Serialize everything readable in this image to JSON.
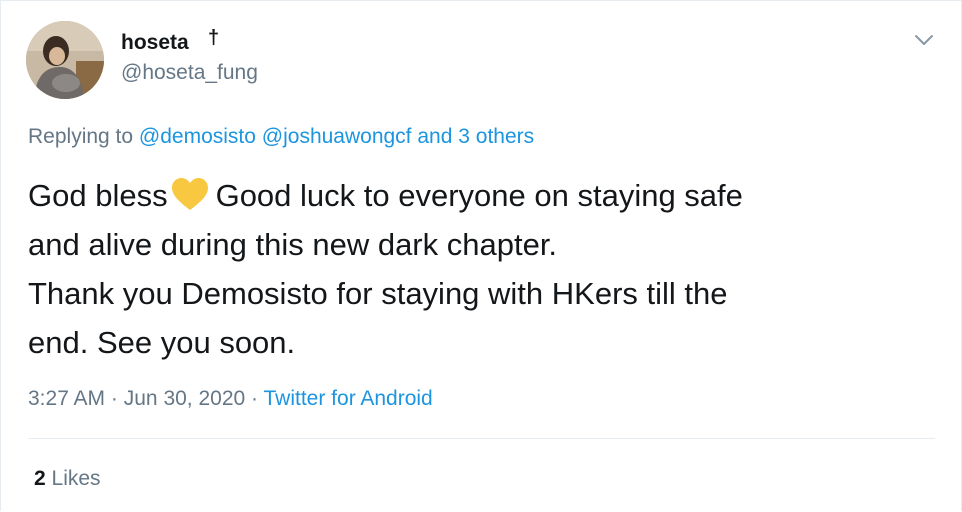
{
  "author": {
    "display_name": "hoseta",
    "name_suffix": "†",
    "handle": "@hoseta_fung"
  },
  "reply": {
    "prefix": "Replying to",
    "mentions": [
      "@demosisto",
      "@joshuawongcf"
    ],
    "others": "and 3 others"
  },
  "tweet": {
    "line1_before": "God bless",
    "emoji": "yellow-heart-icon",
    "line1_after": "Good luck to everyone on staying safe",
    "line2": "and alive during this new dark chapter.",
    "line3": "Thank you Demosisto for staying with HKers till the",
    "line4": "end. See you soon."
  },
  "meta": {
    "time": "3:27 AM",
    "separator": "·",
    "date": "Jun 30, 2020",
    "source": "Twitter for Android"
  },
  "stats": {
    "likes_count": "2",
    "likes_label": "Likes"
  },
  "colors": {
    "text": "#14171a",
    "secondary": "#657786",
    "link": "#1b95e0",
    "heart": "#f8c840"
  }
}
